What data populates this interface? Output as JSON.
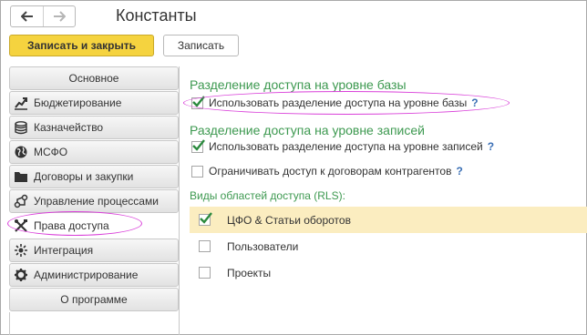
{
  "window": {
    "title": "Константы"
  },
  "nav": {
    "back_icon": "arrow-left-icon",
    "forward_icon": "arrow-right-icon"
  },
  "toolbar": {
    "save_close_label": "Записать и закрыть",
    "save_label": "Записать"
  },
  "sidebar": {
    "items": [
      {
        "label": "Основное",
        "icon": ""
      },
      {
        "label": "Бюджетирование",
        "icon": "chart-up-icon"
      },
      {
        "label": "Казначейство",
        "icon": "coins-icon"
      },
      {
        "label": "МСФО",
        "icon": "globe-icon"
      },
      {
        "label": "Договоры и закупки",
        "icon": "folder-icon"
      },
      {
        "label": "Управление процессами",
        "icon": "process-icon"
      },
      {
        "label": "Права доступа",
        "icon": "tools-icon",
        "active": true
      },
      {
        "label": "Интеграция",
        "icon": "integration-icon"
      },
      {
        "label": "Администрирование",
        "icon": "gear-icon"
      },
      {
        "label": "О программе",
        "icon": ""
      }
    ]
  },
  "content": {
    "section1_title": "Разделение доступа на уровне базы",
    "base_checkbox": {
      "label": "Использовать разделение доступа на уровне базы",
      "checked": true,
      "help": "?"
    },
    "section2_title": "Разделение доступа на уровне записей",
    "records_checkbox": {
      "label": "Использовать разделение доступа на уровне записей",
      "checked": true,
      "help": "?"
    },
    "contracts_checkbox": {
      "label": "Ограничивать доступ к договорам контрагентов",
      "checked": false,
      "help": "?"
    },
    "rls_label": "Виды областей доступа (RLS):",
    "rls_items": [
      {
        "label": "ЦФО & Статьи оборотов",
        "checked": true
      },
      {
        "label": "Пользователи",
        "checked": false
      },
      {
        "label": "Проекты",
        "checked": false
      }
    ]
  },
  "colors": {
    "accent_button": "#f5d33f",
    "section_title": "#3d9950",
    "highlight_oval": "#d93fd9",
    "selected_row": "#fbedc0",
    "help": "#3a6fb5"
  }
}
